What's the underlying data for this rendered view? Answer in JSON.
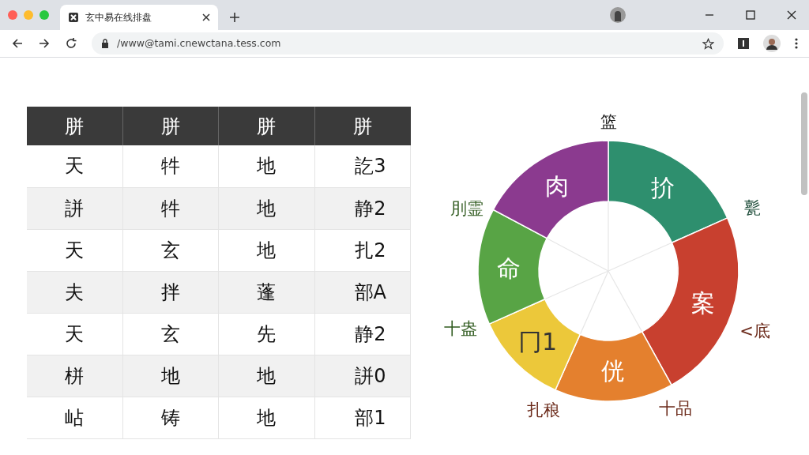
{
  "browser": {
    "tab_title": "玄中易在线排盘",
    "url": "/www@tami.cnewctana.tess.com"
  },
  "table": {
    "columns": [
      "胼",
      "胼",
      "胼",
      "胼"
    ],
    "rows": [
      {
        "cells": [
          "天",
          "牪",
          "地",
          "訖3"
        ]
      },
      {
        "cells": [
          "誁",
          "牪",
          "地",
          "静2"
        ]
      },
      {
        "cells": [
          "天",
          "玄",
          "地",
          "扎2"
        ]
      },
      {
        "cells": [
          "夫",
          "拌",
          "蓬",
          "部A"
        ]
      },
      {
        "cells": [
          "天",
          "玄",
          "先",
          "静2"
        ]
      },
      {
        "cells": [
          "栟",
          "地",
          "地",
          "誁0"
        ]
      },
      {
        "cells": [
          "岾",
          "铸",
          "地",
          "部1"
        ]
      }
    ]
  },
  "wheel": {
    "segments": [
      {
        "label": "扴",
        "color": "#2e8f6e"
      },
      {
        "label": "案",
        "color": "#c8402f"
      },
      {
        "label": "侊",
        "color": "#e4802e"
      },
      {
        "label": "冂1",
        "color": "#ecc83a"
      },
      {
        "label": "命",
        "color": "#58a445"
      },
      {
        "label": "肉",
        "color": "#8b3a8f"
      }
    ],
    "outer_labels": [
      "篮",
      "甏",
      "<底",
      "十品",
      "扎稂",
      "十盎",
      "刖霊"
    ]
  }
}
